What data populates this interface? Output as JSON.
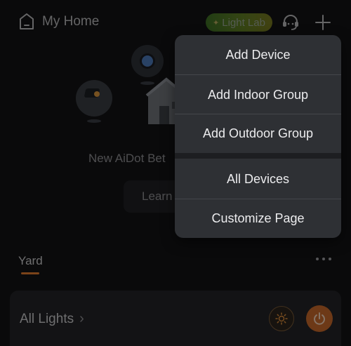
{
  "header": {
    "home_title": "My Home",
    "light_lab_label": "Light Lab"
  },
  "banner": {
    "text": "New AiDot Bet",
    "learn_label": "Learn"
  },
  "room_tabs": [
    {
      "label": "Yard",
      "selected": true
    }
  ],
  "card": {
    "label": "All Lights",
    "power_color": "#c7682a"
  },
  "menu": {
    "items": [
      {
        "label": "Add Device"
      },
      {
        "label": "Add Indoor Group"
      },
      {
        "label": "Add Outdoor Group"
      },
      {
        "label": "All Devices"
      },
      {
        "label": "Customize Page"
      }
    ]
  },
  "colors": {
    "accent": "#e07a2f",
    "background": "#131315",
    "menu_bg": "#2e3034"
  }
}
